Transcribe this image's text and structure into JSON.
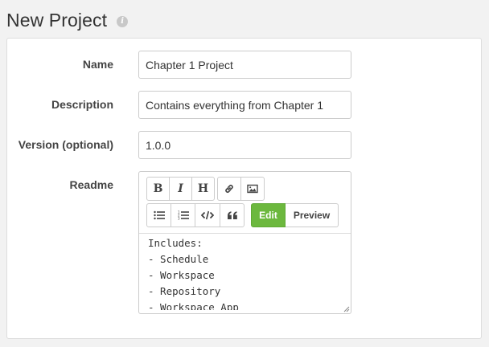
{
  "page": {
    "title": "New Project"
  },
  "form": {
    "name": {
      "label": "Name",
      "value": "Chapter 1 Project"
    },
    "description": {
      "label": "Description",
      "value": "Contains everything from Chapter 1"
    },
    "version": {
      "label": "Version (optional)",
      "value": "1.0.0"
    },
    "readme": {
      "label": "Readme",
      "toolbar": {
        "bold": "B",
        "italic": "I",
        "heading": "H",
        "edit_label": "Edit",
        "preview_label": "Preview"
      },
      "lines": [
        "Includes:",
        "- Schedule",
        "- Workspace",
        "- Repository",
        "- Workspace App"
      ]
    }
  },
  "colors": {
    "accent": "#6cb83e",
    "background": "#f2f2f2"
  }
}
